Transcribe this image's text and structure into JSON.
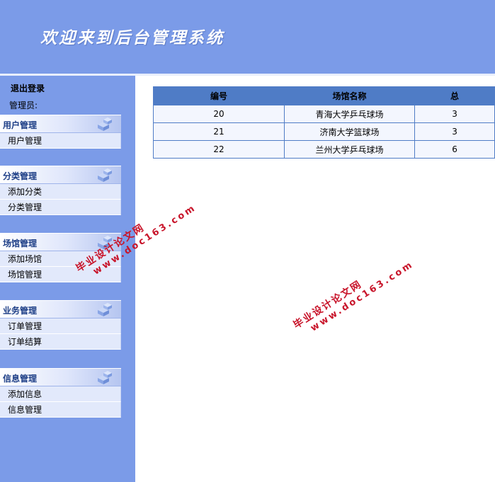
{
  "header": {
    "title": "欢迎来到后台管理系统"
  },
  "sidebar": {
    "logout_label": "退出登录",
    "admin_label": "管理员:",
    "groups": [
      {
        "title": "用户管理",
        "items": [
          "用户管理"
        ]
      },
      {
        "title": "分类管理",
        "items": [
          "添加分类",
          "分类管理"
        ]
      },
      {
        "title": "场馆管理",
        "items": [
          "添加场馆",
          "场馆管理"
        ]
      },
      {
        "title": "业务管理",
        "items": [
          "订单管理",
          "订单结算"
        ]
      },
      {
        "title": "信息管理",
        "items": [
          "添加信息",
          "信息管理"
        ]
      }
    ]
  },
  "table": {
    "headers": [
      "编号",
      "场馆名称",
      "总"
    ],
    "rows": [
      [
        "20",
        "青海大学乒乓球场",
        "3"
      ],
      [
        "21",
        "济南大学篮球场",
        "3"
      ],
      [
        "22",
        "兰州大学乒乓球场",
        "6"
      ]
    ]
  },
  "watermark": {
    "line1": "毕业设计论文网",
    "line2": "www.doc163.com"
  },
  "colors": {
    "header_bg": "#7b9be8",
    "table_header": "#4f7cc6",
    "watermark": "#c8142a"
  }
}
